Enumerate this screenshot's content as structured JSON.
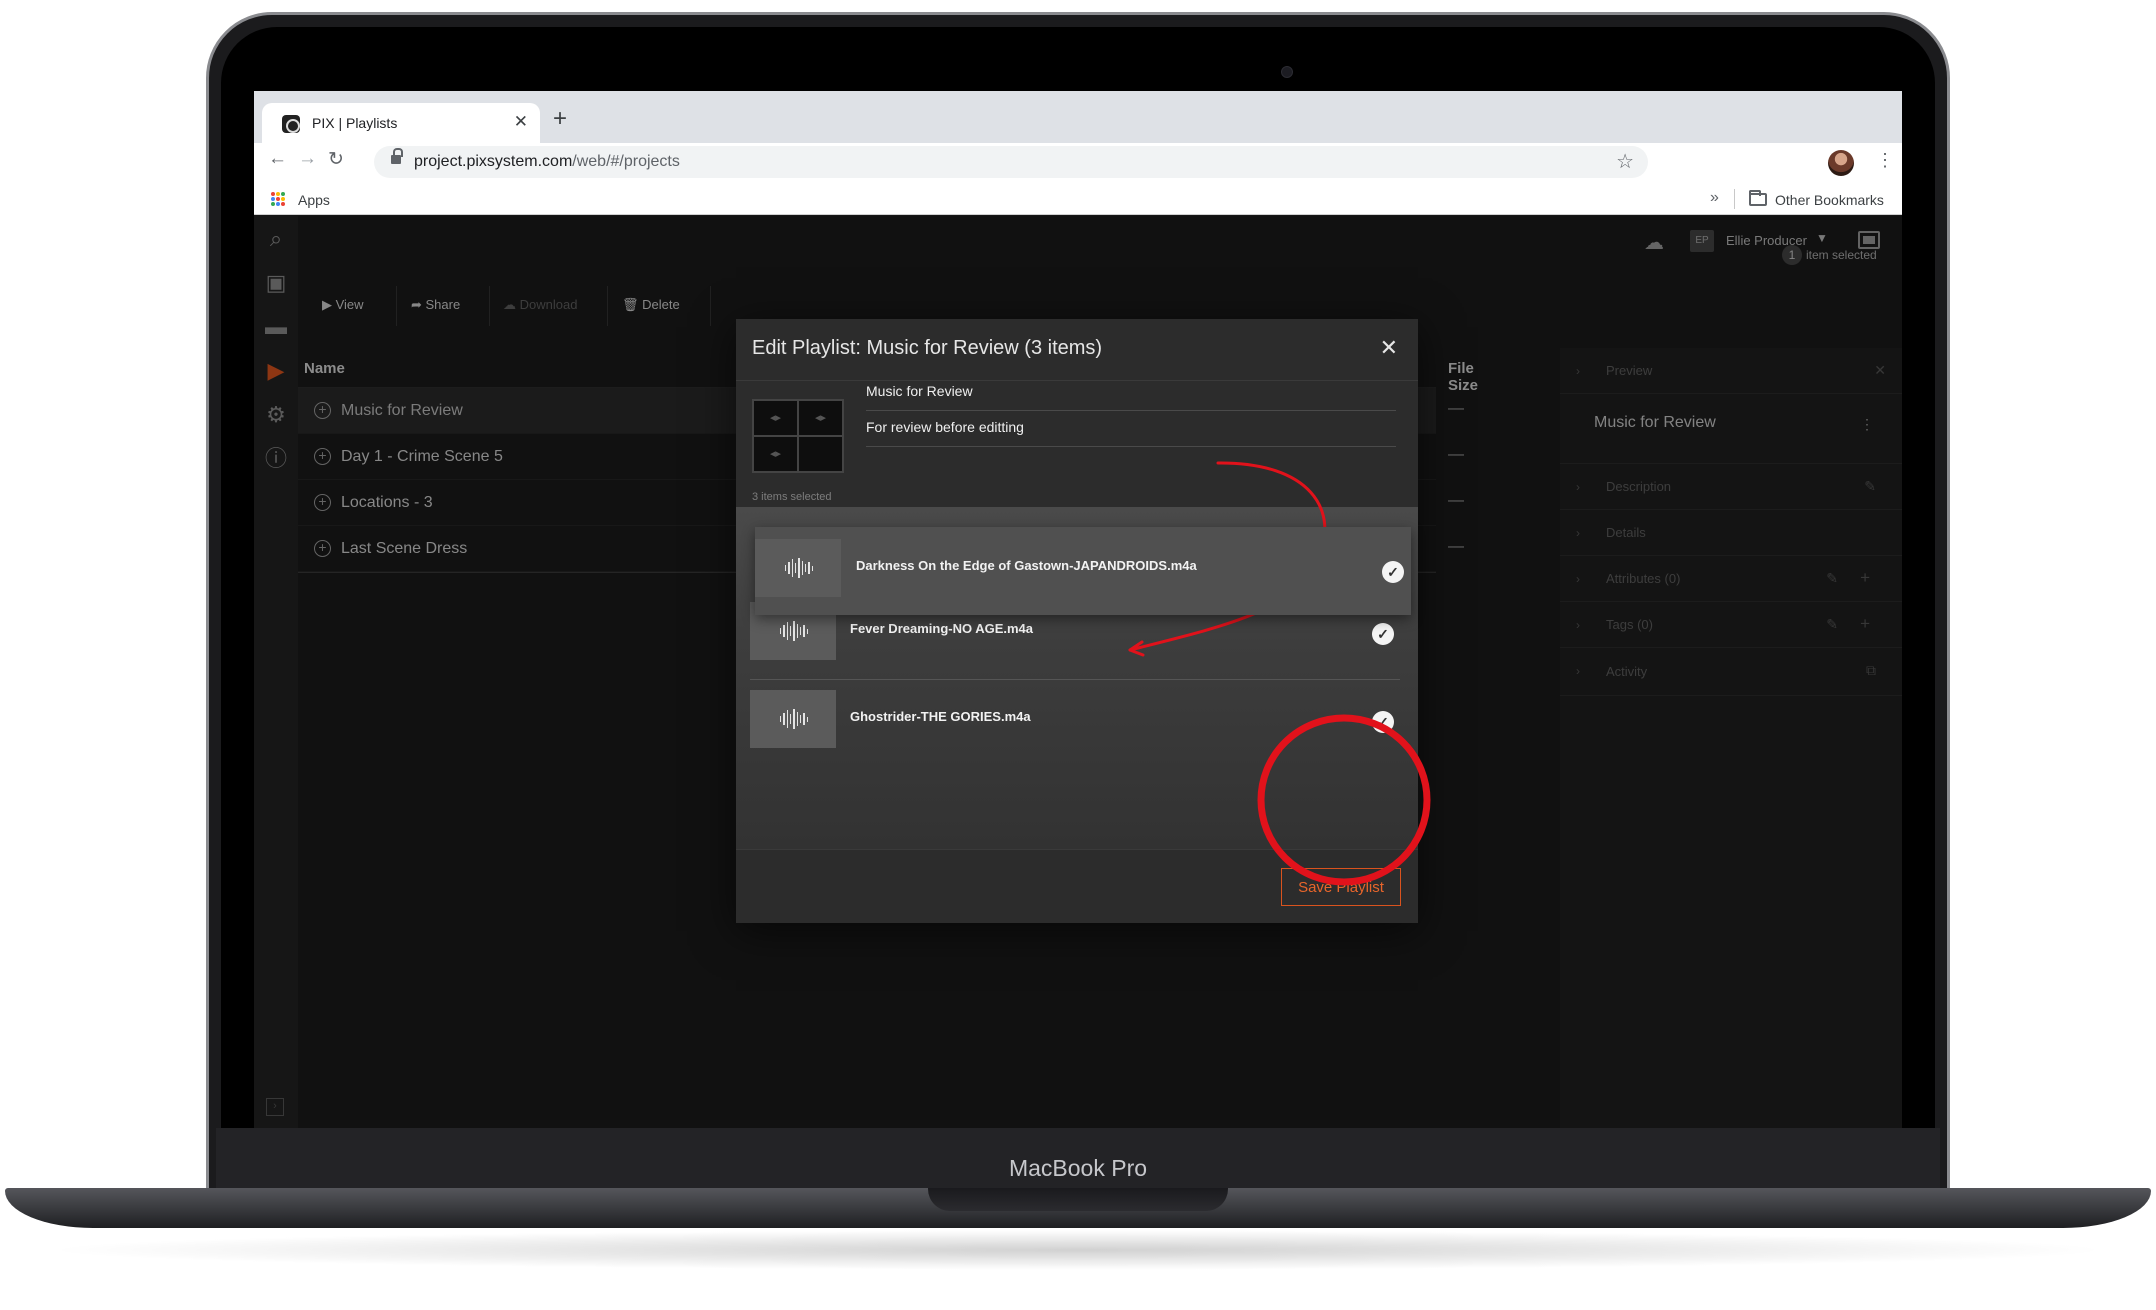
{
  "device": {
    "brand_label": "MacBook Pro"
  },
  "browser": {
    "tab_title": "PIX | Playlists",
    "url_host": "project.pixsystem.com",
    "url_path": "/web/#/projects",
    "bookmarks": {
      "apps_label": "Apps",
      "other_label": "Other Bookmarks",
      "overflow_label": "»"
    }
  },
  "topbar": {
    "user_initials": "EP",
    "user_name": "Ellie Producer"
  },
  "toolbar": {
    "view_label": "View",
    "share_label": "Share",
    "download_label": "Download",
    "delete_label": "Delete",
    "selection_count": "1",
    "selection_text": "item selected"
  },
  "table": {
    "columns": {
      "name": "Name",
      "file_size": "File Size"
    },
    "rows": [
      {
        "name": "Music for Review",
        "size": "—"
      },
      {
        "name": "Day 1 - Crime Scene 5",
        "size": "—"
      },
      {
        "name": "Locations - 3",
        "size": "—"
      },
      {
        "name": "Last Scene Dress",
        "size": "—"
      }
    ]
  },
  "right_panel": {
    "preview_label": "Preview",
    "title": "Music for Review",
    "sections": [
      "Description",
      "Details",
      "Attributes (0)",
      "Tags (0)",
      "Activity"
    ]
  },
  "modal": {
    "title": "Edit Playlist: Music for Review (3 items)",
    "name_value": "Music for Review",
    "description_value": "For review before editting",
    "items_selected": "3 items selected",
    "items": [
      {
        "name": "Darkness On the Edge of Gastown-JAPANDROIDS.m4a"
      },
      {
        "name": "Fever Dreaming-NO AGE.m4a"
      },
      {
        "name": "Ghostrider-THE GORIES.m4a"
      }
    ],
    "save_label": "Save Playlist"
  },
  "colors": {
    "accent": "#d9531e",
    "annotation": "#e1121b"
  }
}
